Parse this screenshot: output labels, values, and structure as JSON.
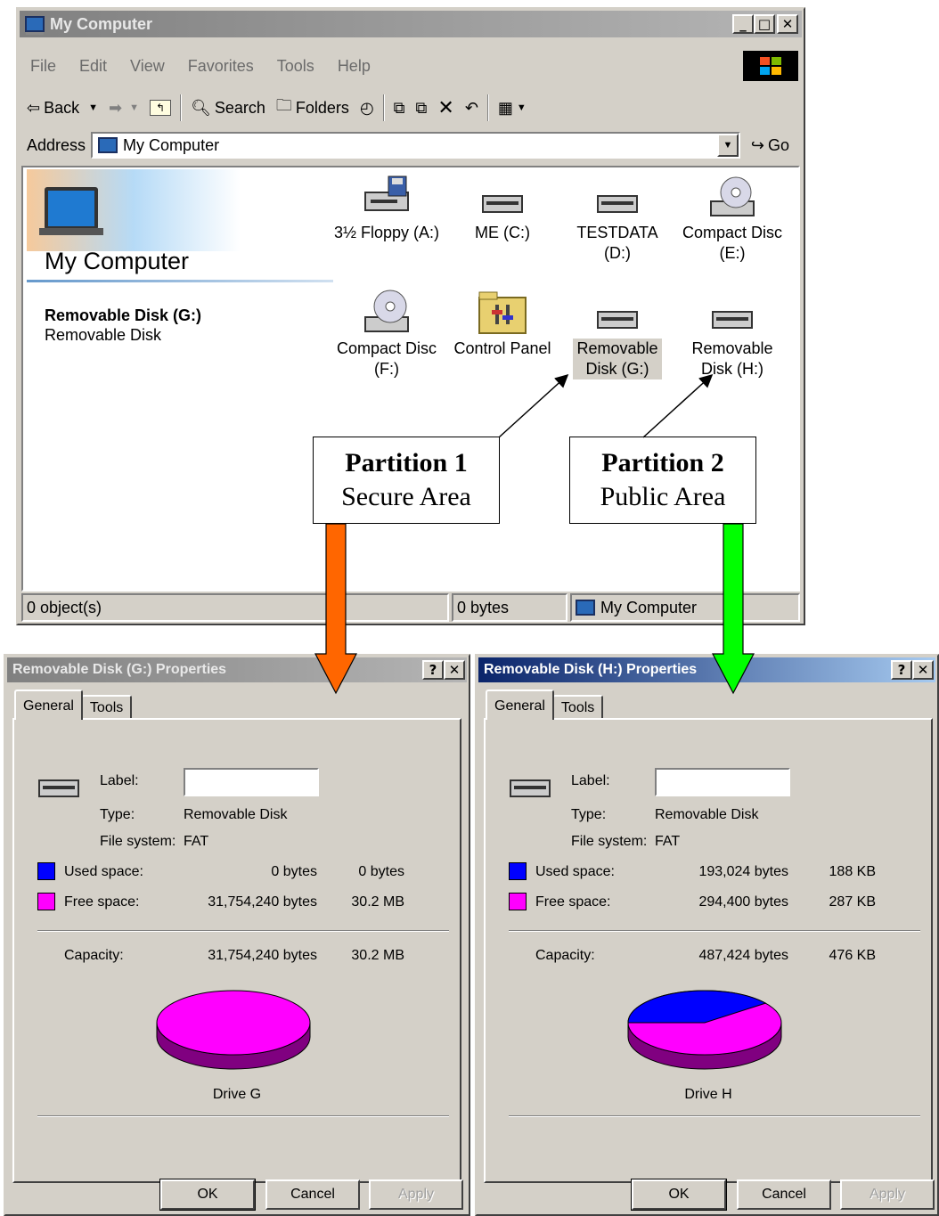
{
  "explorer": {
    "title": "My Computer",
    "menu": [
      "File",
      "Edit",
      "View",
      "Favorites",
      "Tools",
      "Help"
    ],
    "toolbar": {
      "back": "Back",
      "search": "Search",
      "folders": "Folders"
    },
    "address": {
      "label": "Address",
      "value": "My Computer",
      "go": "Go"
    },
    "panel": {
      "heading": "My Computer",
      "selected_name": "Removable Disk (G:)",
      "selected_type": "Removable Disk"
    },
    "icons": [
      {
        "line1": "3½ Floppy (A:)",
        "line2": ""
      },
      {
        "line1": "ME (C:)",
        "line2": ""
      },
      {
        "line1": "TESTDATA",
        "line2": "(D:)"
      },
      {
        "line1": "Compact Disc",
        "line2": "(E:)"
      },
      {
        "line1": "Compact Disc",
        "line2": "(F:)"
      },
      {
        "line1": "Control Panel",
        "line2": ""
      },
      {
        "line1": "Removable",
        "line2": "Disk (G:)"
      },
      {
        "line1": "Removable",
        "line2": "Disk (H:)"
      }
    ],
    "status": {
      "objects": "0 object(s)",
      "size": "0 bytes",
      "zone": "My Computer"
    }
  },
  "callouts": {
    "p1": {
      "title": "Partition 1",
      "sub": "Secure Area",
      "arrow_color": "#ff6600"
    },
    "p2": {
      "title": "Partition 2",
      "sub": "Public Area",
      "arrow_color": "#00ff00"
    }
  },
  "dialog_g": {
    "title": "Removable Disk (G:) Properties",
    "tabs": [
      "General",
      "Tools"
    ],
    "label_caption": "Label:",
    "type_caption": "Type:",
    "type_value": "Removable Disk",
    "fs_caption": "File system:",
    "fs_value": "FAT",
    "used_caption": "Used space:",
    "used_bytes": "0 bytes",
    "used_short": "0 bytes",
    "free_caption": "Free space:",
    "free_bytes": "31,754,240 bytes",
    "free_short": "30.2 MB",
    "cap_caption": "Capacity:",
    "cap_bytes": "31,754,240 bytes",
    "cap_short": "30.2 MB",
    "drive_caption": "Drive G",
    "used_fraction": 0,
    "ok": "OK",
    "cancel": "Cancel",
    "apply": "Apply"
  },
  "dialog_h": {
    "title": "Removable Disk (H:) Properties",
    "tabs": [
      "General",
      "Tools"
    ],
    "label_caption": "Label:",
    "type_caption": "Type:",
    "type_value": "Removable Disk",
    "fs_caption": "File system:",
    "fs_value": "FAT",
    "used_caption": "Used space:",
    "used_bytes": "193,024 bytes",
    "used_short": "188 KB",
    "free_caption": "Free space:",
    "free_bytes": "294,400 bytes",
    "free_short": "287 KB",
    "cap_caption": "Capacity:",
    "cap_bytes": "487,424 bytes",
    "cap_short": "476 KB",
    "drive_caption": "Drive H",
    "used_fraction": 0.396,
    "ok": "OK",
    "cancel": "Cancel",
    "apply": "Apply"
  },
  "colors": {
    "used": "#0000ff",
    "free": "#ff00ff",
    "free_side": "#800080",
    "used_side": "#000080"
  }
}
